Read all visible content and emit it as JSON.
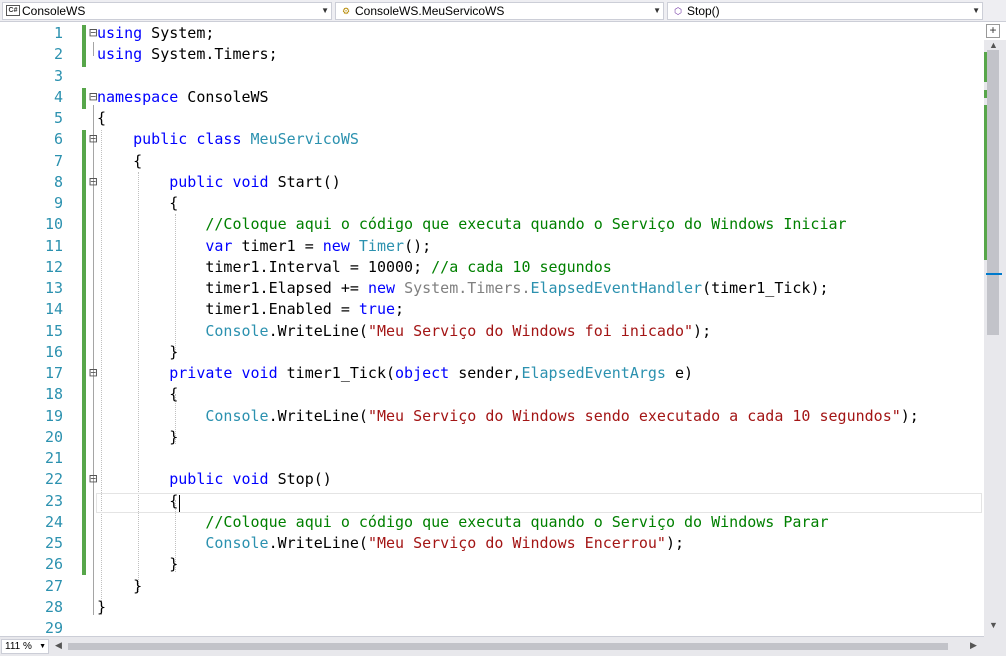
{
  "navbar": {
    "project": "ConsoleWS",
    "class": "ConsoleWS.MeuServicoWS",
    "member": "Stop()"
  },
  "zoom": "111 %",
  "colors": {
    "keyword": "#0000ff",
    "type": "#2b91af",
    "string": "#a31515",
    "comment": "#008000",
    "line_number": "#2b91af",
    "change_bar": "#57a64a"
  },
  "lines": [
    {
      "n": "1",
      "collapse": "minus",
      "tokens": [
        {
          "k": "k",
          "t": "using"
        },
        {
          "k": "p",
          "t": " System;"
        }
      ]
    },
    {
      "n": "2",
      "tokens": [
        {
          "k": "k",
          "t": "using"
        },
        {
          "k": "p",
          "t": " System.Timers;"
        }
      ]
    },
    {
      "n": "3",
      "tokens": []
    },
    {
      "n": "4",
      "collapse": "minus",
      "tokens": [
        {
          "k": "k",
          "t": "namespace"
        },
        {
          "k": "p",
          "t": " ConsoleWS"
        }
      ]
    },
    {
      "n": "5",
      "tokens": [
        {
          "k": "p",
          "t": "{"
        }
      ]
    },
    {
      "n": "6",
      "collapse": "minus",
      "tokens": [
        {
          "k": "p",
          "t": "    "
        },
        {
          "k": "k",
          "t": "public"
        },
        {
          "k": "p",
          "t": " "
        },
        {
          "k": "k",
          "t": "class"
        },
        {
          "k": "p",
          "t": " "
        },
        {
          "k": "t",
          "t": "MeuServicoWS"
        }
      ]
    },
    {
      "n": "7",
      "tokens": [
        {
          "k": "p",
          "t": "    {"
        }
      ]
    },
    {
      "n": "8",
      "collapse": "minus",
      "tokens": [
        {
          "k": "p",
          "t": "        "
        },
        {
          "k": "k",
          "t": "public"
        },
        {
          "k": "p",
          "t": " "
        },
        {
          "k": "k",
          "t": "void"
        },
        {
          "k": "p",
          "t": " Start()"
        }
      ]
    },
    {
      "n": "9",
      "tokens": [
        {
          "k": "p",
          "t": "        {"
        }
      ]
    },
    {
      "n": "10",
      "tokens": [
        {
          "k": "p",
          "t": "            "
        },
        {
          "k": "c",
          "t": "//Coloque aqui o código que executa quando o Serviço do Windows Iniciar"
        }
      ]
    },
    {
      "n": "11",
      "tokens": [
        {
          "k": "p",
          "t": "            "
        },
        {
          "k": "k",
          "t": "var"
        },
        {
          "k": "p",
          "t": " timer1 = "
        },
        {
          "k": "k",
          "t": "new"
        },
        {
          "k": "p",
          "t": " "
        },
        {
          "k": "t",
          "t": "Timer"
        },
        {
          "k": "p",
          "t": "();"
        }
      ]
    },
    {
      "n": "12",
      "tokens": [
        {
          "k": "p",
          "t": "            timer1.Interval = 10000; "
        },
        {
          "k": "c",
          "t": "//a cada 10 segundos"
        }
      ]
    },
    {
      "n": "13",
      "tokens": [
        {
          "k": "p",
          "t": "            timer1.Elapsed += "
        },
        {
          "k": "k",
          "t": "new"
        },
        {
          "k": "p",
          "t": " "
        },
        {
          "k": "g",
          "t": "System.Timers."
        },
        {
          "k": "t",
          "t": "ElapsedEventHandler"
        },
        {
          "k": "p",
          "t": "(timer1_Tick);"
        }
      ]
    },
    {
      "n": "14",
      "tokens": [
        {
          "k": "p",
          "t": "            timer1.Enabled = "
        },
        {
          "k": "k",
          "t": "true"
        },
        {
          "k": "p",
          "t": ";"
        }
      ]
    },
    {
      "n": "15",
      "tokens": [
        {
          "k": "p",
          "t": "            "
        },
        {
          "k": "t",
          "t": "Console"
        },
        {
          "k": "p",
          "t": ".WriteLine("
        },
        {
          "k": "s",
          "t": "\"Meu Serviço do Windows foi inicado\""
        },
        {
          "k": "p",
          "t": ");"
        }
      ]
    },
    {
      "n": "16",
      "tokens": [
        {
          "k": "p",
          "t": "        }"
        }
      ]
    },
    {
      "n": "17",
      "collapse": "minus",
      "tokens": [
        {
          "k": "p",
          "t": "        "
        },
        {
          "k": "k",
          "t": "private"
        },
        {
          "k": "p",
          "t": " "
        },
        {
          "k": "k",
          "t": "void"
        },
        {
          "k": "p",
          "t": " timer1_Tick("
        },
        {
          "k": "k",
          "t": "object"
        },
        {
          "k": "p",
          "t": " sender,"
        },
        {
          "k": "t",
          "t": "ElapsedEventArgs"
        },
        {
          "k": "p",
          "t": " e)"
        }
      ]
    },
    {
      "n": "18",
      "tokens": [
        {
          "k": "p",
          "t": "        {"
        }
      ]
    },
    {
      "n": "19",
      "tokens": [
        {
          "k": "p",
          "t": "            "
        },
        {
          "k": "t",
          "t": "Console"
        },
        {
          "k": "p",
          "t": ".WriteLine("
        },
        {
          "k": "s",
          "t": "\"Meu Serviço do Windows sendo executado a cada 10 segundos\""
        },
        {
          "k": "p",
          "t": ");"
        }
      ]
    },
    {
      "n": "20",
      "tokens": [
        {
          "k": "p",
          "t": "        }"
        }
      ]
    },
    {
      "n": "21",
      "tokens": []
    },
    {
      "n": "22",
      "collapse": "minus",
      "tokens": [
        {
          "k": "p",
          "t": "        "
        },
        {
          "k": "k",
          "t": "public"
        },
        {
          "k": "p",
          "t": " "
        },
        {
          "k": "k",
          "t": "void"
        },
        {
          "k": "p",
          "t": " Stop()"
        }
      ]
    },
    {
      "n": "23",
      "tokens": [
        {
          "k": "p",
          "t": "        {"
        }
      ]
    },
    {
      "n": "24",
      "tokens": [
        {
          "k": "p",
          "t": "            "
        },
        {
          "k": "c",
          "t": "//Coloque aqui o código que executa quando o Serviço do Windows Parar"
        }
      ]
    },
    {
      "n": "25",
      "tokens": [
        {
          "k": "p",
          "t": "            "
        },
        {
          "k": "t",
          "t": "Console"
        },
        {
          "k": "p",
          "t": ".WriteLine("
        },
        {
          "k": "s",
          "t": "\"Meu Serviço do Windows Encerrou\""
        },
        {
          "k": "p",
          "t": ");"
        }
      ]
    },
    {
      "n": "26",
      "tokens": [
        {
          "k": "p",
          "t": "        }"
        }
      ]
    },
    {
      "n": "27",
      "tokens": [
        {
          "k": "p",
          "t": "    }"
        }
      ]
    },
    {
      "n": "28",
      "tokens": [
        {
          "k": "p",
          "t": "}"
        }
      ]
    },
    {
      "n": "29",
      "tokens": []
    }
  ]
}
